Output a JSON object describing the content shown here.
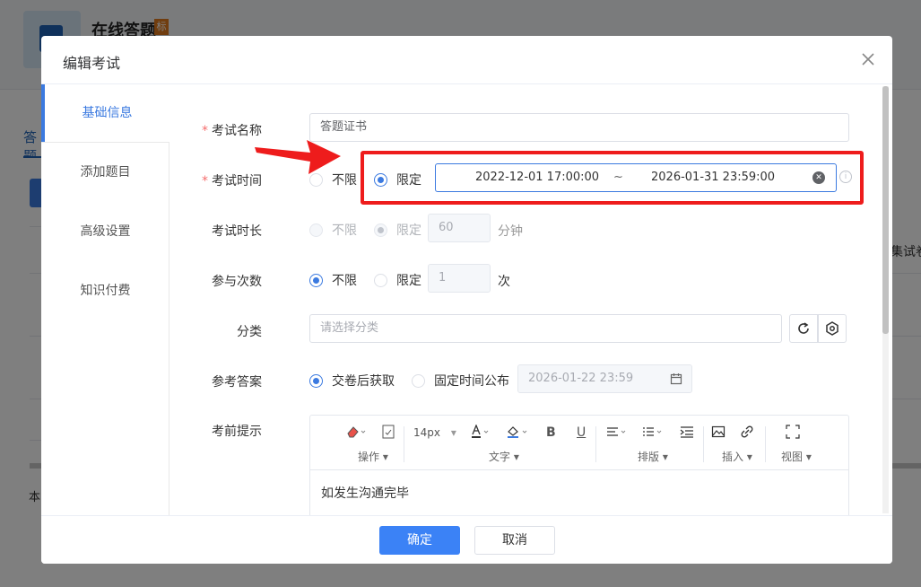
{
  "background": {
    "app_title": "在线答题",
    "app_badge": "标",
    "tab_label": "答题",
    "right_column_header": "集试卷",
    "bottom_text": "本"
  },
  "modal": {
    "title": "编辑考试",
    "sidebar": [
      {
        "label": "基础信息",
        "active": true
      },
      {
        "label": "添加题目",
        "active": false
      },
      {
        "label": "高级设置",
        "active": false
      },
      {
        "label": "知识付费",
        "active": false
      }
    ],
    "form": {
      "name": {
        "label": "考试名称",
        "value": "答题证书"
      },
      "time": {
        "label": "考试时间",
        "option_unlimited": "不限",
        "option_limited": "限定",
        "selected": "limited",
        "start": "2022-12-01 17:00:00",
        "separator": "~",
        "end": "2026-01-31 23:59:00"
      },
      "duration": {
        "label": "考试时长",
        "option_unlimited": "不限",
        "option_limited": "限定",
        "value": "60",
        "unit": "分钟"
      },
      "attempts": {
        "label": "参与次数",
        "option_unlimited": "不限",
        "option_limited": "限定",
        "value": "1",
        "unit": "次"
      },
      "category": {
        "label": "分类",
        "placeholder": "请选择分类"
      },
      "answer": {
        "label": "参考答案",
        "option_after": "交卷后获取",
        "option_fixed": "固定时间公布",
        "date": "2026-01-22 23:59"
      },
      "tips": {
        "label": "考前提示",
        "font_size": "14px",
        "groups": [
          "操作",
          "文字",
          "排版",
          "插入",
          "视图"
        ],
        "content": "如发生沟通完毕"
      }
    },
    "buttons": {
      "confirm": "确定",
      "cancel": "取消"
    }
  },
  "colors": {
    "accent": "#3b7ae0",
    "highlight": "#ee1c1c",
    "required": "#f56c6c"
  }
}
